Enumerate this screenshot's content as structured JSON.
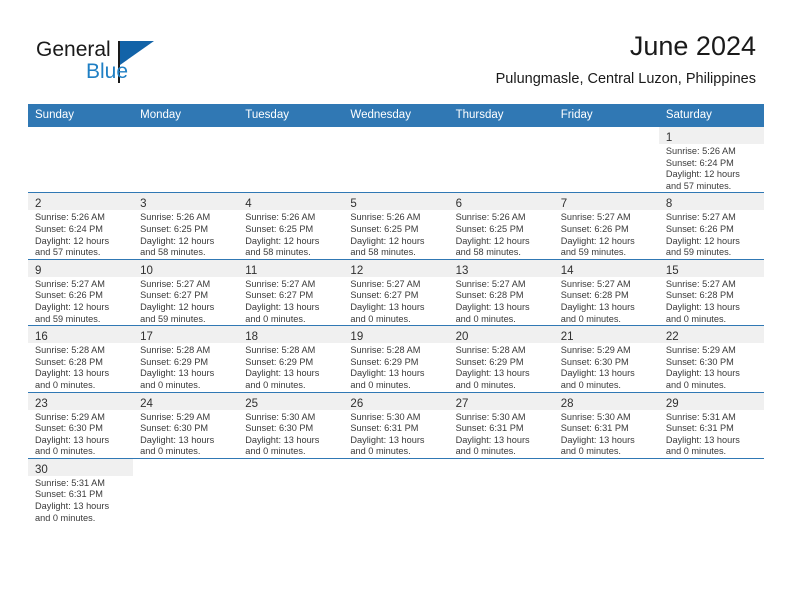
{
  "brand": {
    "name_part1": "General",
    "name_part2": "Blue",
    "logo_icon": "triangle-flag-icon"
  },
  "header": {
    "month_title": "June 2024",
    "location": "Pulungmasle, Central Luzon, Philippines"
  },
  "colors": {
    "header_blue": "#3078b4",
    "brand_blue": "#1f7fc4",
    "daynum_band": "#f0f0f0"
  },
  "calendar": {
    "weekday_headers": [
      "Sunday",
      "Monday",
      "Tuesday",
      "Wednesday",
      "Thursday",
      "Friday",
      "Saturday"
    ],
    "weeks": [
      [
        {
          "day": "",
          "blank": true,
          "lines": []
        },
        {
          "day": "",
          "blank": true,
          "lines": []
        },
        {
          "day": "",
          "blank": true,
          "lines": []
        },
        {
          "day": "",
          "blank": true,
          "lines": []
        },
        {
          "day": "",
          "blank": true,
          "lines": []
        },
        {
          "day": "",
          "blank": true,
          "lines": []
        },
        {
          "day": "1",
          "lines": [
            "Sunrise: 5:26 AM",
            "Sunset: 6:24 PM",
            "Daylight: 12 hours",
            "and 57 minutes."
          ]
        }
      ],
      [
        {
          "day": "2",
          "lines": [
            "Sunrise: 5:26 AM",
            "Sunset: 6:24 PM",
            "Daylight: 12 hours",
            "and 57 minutes."
          ]
        },
        {
          "day": "3",
          "lines": [
            "Sunrise: 5:26 AM",
            "Sunset: 6:25 PM",
            "Daylight: 12 hours",
            "and 58 minutes."
          ]
        },
        {
          "day": "4",
          "lines": [
            "Sunrise: 5:26 AM",
            "Sunset: 6:25 PM",
            "Daylight: 12 hours",
            "and 58 minutes."
          ]
        },
        {
          "day": "5",
          "lines": [
            "Sunrise: 5:26 AM",
            "Sunset: 6:25 PM",
            "Daylight: 12 hours",
            "and 58 minutes."
          ]
        },
        {
          "day": "6",
          "lines": [
            "Sunrise: 5:26 AM",
            "Sunset: 6:25 PM",
            "Daylight: 12 hours",
            "and 58 minutes."
          ]
        },
        {
          "day": "7",
          "lines": [
            "Sunrise: 5:27 AM",
            "Sunset: 6:26 PM",
            "Daylight: 12 hours",
            "and 59 minutes."
          ]
        },
        {
          "day": "8",
          "lines": [
            "Sunrise: 5:27 AM",
            "Sunset: 6:26 PM",
            "Daylight: 12 hours",
            "and 59 minutes."
          ]
        }
      ],
      [
        {
          "day": "9",
          "lines": [
            "Sunrise: 5:27 AM",
            "Sunset: 6:26 PM",
            "Daylight: 12 hours",
            "and 59 minutes."
          ]
        },
        {
          "day": "10",
          "lines": [
            "Sunrise: 5:27 AM",
            "Sunset: 6:27 PM",
            "Daylight: 12 hours",
            "and 59 minutes."
          ]
        },
        {
          "day": "11",
          "lines": [
            "Sunrise: 5:27 AM",
            "Sunset: 6:27 PM",
            "Daylight: 13 hours",
            "and 0 minutes."
          ]
        },
        {
          "day": "12",
          "lines": [
            "Sunrise: 5:27 AM",
            "Sunset: 6:27 PM",
            "Daylight: 13 hours",
            "and 0 minutes."
          ]
        },
        {
          "day": "13",
          "lines": [
            "Sunrise: 5:27 AM",
            "Sunset: 6:28 PM",
            "Daylight: 13 hours",
            "and 0 minutes."
          ]
        },
        {
          "day": "14",
          "lines": [
            "Sunrise: 5:27 AM",
            "Sunset: 6:28 PM",
            "Daylight: 13 hours",
            "and 0 minutes."
          ]
        },
        {
          "day": "15",
          "lines": [
            "Sunrise: 5:27 AM",
            "Sunset: 6:28 PM",
            "Daylight: 13 hours",
            "and 0 minutes."
          ]
        }
      ],
      [
        {
          "day": "16",
          "lines": [
            "Sunrise: 5:28 AM",
            "Sunset: 6:28 PM",
            "Daylight: 13 hours",
            "and 0 minutes."
          ]
        },
        {
          "day": "17",
          "lines": [
            "Sunrise: 5:28 AM",
            "Sunset: 6:29 PM",
            "Daylight: 13 hours",
            "and 0 minutes."
          ]
        },
        {
          "day": "18",
          "lines": [
            "Sunrise: 5:28 AM",
            "Sunset: 6:29 PM",
            "Daylight: 13 hours",
            "and 0 minutes."
          ]
        },
        {
          "day": "19",
          "lines": [
            "Sunrise: 5:28 AM",
            "Sunset: 6:29 PM",
            "Daylight: 13 hours",
            "and 0 minutes."
          ]
        },
        {
          "day": "20",
          "lines": [
            "Sunrise: 5:28 AM",
            "Sunset: 6:29 PM",
            "Daylight: 13 hours",
            "and 0 minutes."
          ]
        },
        {
          "day": "21",
          "lines": [
            "Sunrise: 5:29 AM",
            "Sunset: 6:30 PM",
            "Daylight: 13 hours",
            "and 0 minutes."
          ]
        },
        {
          "day": "22",
          "lines": [
            "Sunrise: 5:29 AM",
            "Sunset: 6:30 PM",
            "Daylight: 13 hours",
            "and 0 minutes."
          ]
        }
      ],
      [
        {
          "day": "23",
          "lines": [
            "Sunrise: 5:29 AM",
            "Sunset: 6:30 PM",
            "Daylight: 13 hours",
            "and 0 minutes."
          ]
        },
        {
          "day": "24",
          "lines": [
            "Sunrise: 5:29 AM",
            "Sunset: 6:30 PM",
            "Daylight: 13 hours",
            "and 0 minutes."
          ]
        },
        {
          "day": "25",
          "lines": [
            "Sunrise: 5:30 AM",
            "Sunset: 6:30 PM",
            "Daylight: 13 hours",
            "and 0 minutes."
          ]
        },
        {
          "day": "26",
          "lines": [
            "Sunrise: 5:30 AM",
            "Sunset: 6:31 PM",
            "Daylight: 13 hours",
            "and 0 minutes."
          ]
        },
        {
          "day": "27",
          "lines": [
            "Sunrise: 5:30 AM",
            "Sunset: 6:31 PM",
            "Daylight: 13 hours",
            "and 0 minutes."
          ]
        },
        {
          "day": "28",
          "lines": [
            "Sunrise: 5:30 AM",
            "Sunset: 6:31 PM",
            "Daylight: 13 hours",
            "and 0 minutes."
          ]
        },
        {
          "day": "29",
          "lines": [
            "Sunrise: 5:31 AM",
            "Sunset: 6:31 PM",
            "Daylight: 13 hours",
            "and 0 minutes."
          ]
        }
      ],
      [
        {
          "day": "30",
          "lines": [
            "Sunrise: 5:31 AM",
            "Sunset: 6:31 PM",
            "Daylight: 13 hours",
            "and 0 minutes."
          ]
        },
        {
          "day": "",
          "blank": true,
          "lines": []
        },
        {
          "day": "",
          "blank": true,
          "lines": []
        },
        {
          "day": "",
          "blank": true,
          "lines": []
        },
        {
          "day": "",
          "blank": true,
          "lines": []
        },
        {
          "day": "",
          "blank": true,
          "lines": []
        },
        {
          "day": "",
          "blank": true,
          "lines": []
        }
      ]
    ]
  }
}
